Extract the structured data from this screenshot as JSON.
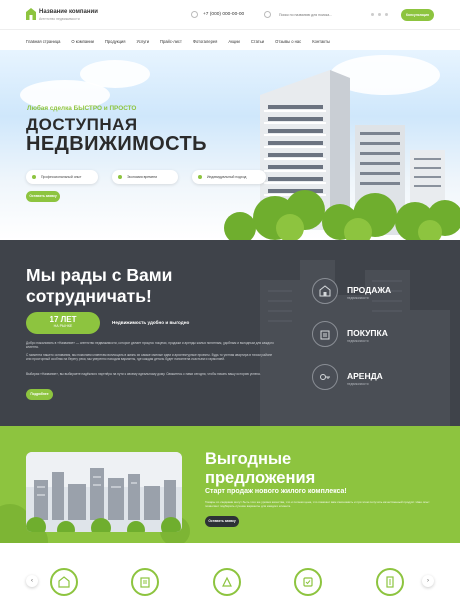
{
  "header": {
    "company_name": "Название компании",
    "company_subtitle": "Агентство недвижимости",
    "phone": "+7 (000) 000-00-00",
    "search_placeholder": "Поиск по названию для поиска...",
    "button": "Консультация"
  },
  "nav": [
    "Главная страница",
    "О компании",
    "Продукция",
    "Услуги",
    "Прайс-лист",
    "Фотогалерея",
    "Акции",
    "Статьи",
    "Отзывы о нас",
    "Контакты"
  ],
  "hero": {
    "tagline": "Любая сделка БЫСТРО и ПРОСТО",
    "title_line1": "ДОСТУПНАЯ",
    "title_line2": "НЕДВИЖИМОСТЬ",
    "features": [
      "Профессиональный опыт",
      "Экономия времени",
      "Индивидуальный подход"
    ],
    "button": "Оставить заявку"
  },
  "about": {
    "title_line1": "Мы рады с Вами",
    "title_line2": "сотрудничать!",
    "years_value": "17 ЛЕТ",
    "years_label": "НА РЫНКЕ",
    "years_caption": "Недвижимость удобно и выгодно",
    "para1": "Добро пожаловать в «Название» — агентство недвижимости, которое делает процесс покупки, продажи и аренды жилья понятным, удобным и выгодным для каждого клиента.",
    "para2": "С момента нашего основания, мы помогаем клиентам воплощать в жизнь их самые смелые идеи и архитектурные проекты. Будь то уютная квартира в тихом районе или просторный особняк на берегу реки, мы уверенно находим варианты, где каждая деталь будет наполнена счастьем и гармонией.",
    "para3": "Выбирая «Название», вы выбираете надёжного партнёра на пути к своему идеальному дому. Свяжитесь с нами сегодня, чтобы начать вашу историю успеха.",
    "button": "Подробнее",
    "services": [
      {
        "title": "ПРОДАЖА",
        "subtitle": "недвижимости"
      },
      {
        "title": "ПОКУПКА",
        "subtitle": "недвижимости"
      },
      {
        "title": "АРЕНДА",
        "subtitle": "недвижимости"
      }
    ]
  },
  "promo": {
    "title_line1": "Выгодные",
    "title_line2": "предложения",
    "subtitle": "Старт продаж нового жилого комплекса!",
    "text": "Товары со скидками могут быть того же уровня качества, что и полная цена, что поможет вам сэкономить и при этом получить качественный продукт. Наш опыт позволяет подбирать лучшие варианты для каждого клиента.",
    "button": "Оставить заявку"
  },
  "colors": {
    "accent": "#8dc43f",
    "dark": "#3f434a"
  },
  "icons": [
    "phone-icon",
    "search-icon",
    "house-sale-icon",
    "house-buy-icon",
    "key-icon",
    "arrow-left-icon",
    "arrow-right-icon"
  ]
}
